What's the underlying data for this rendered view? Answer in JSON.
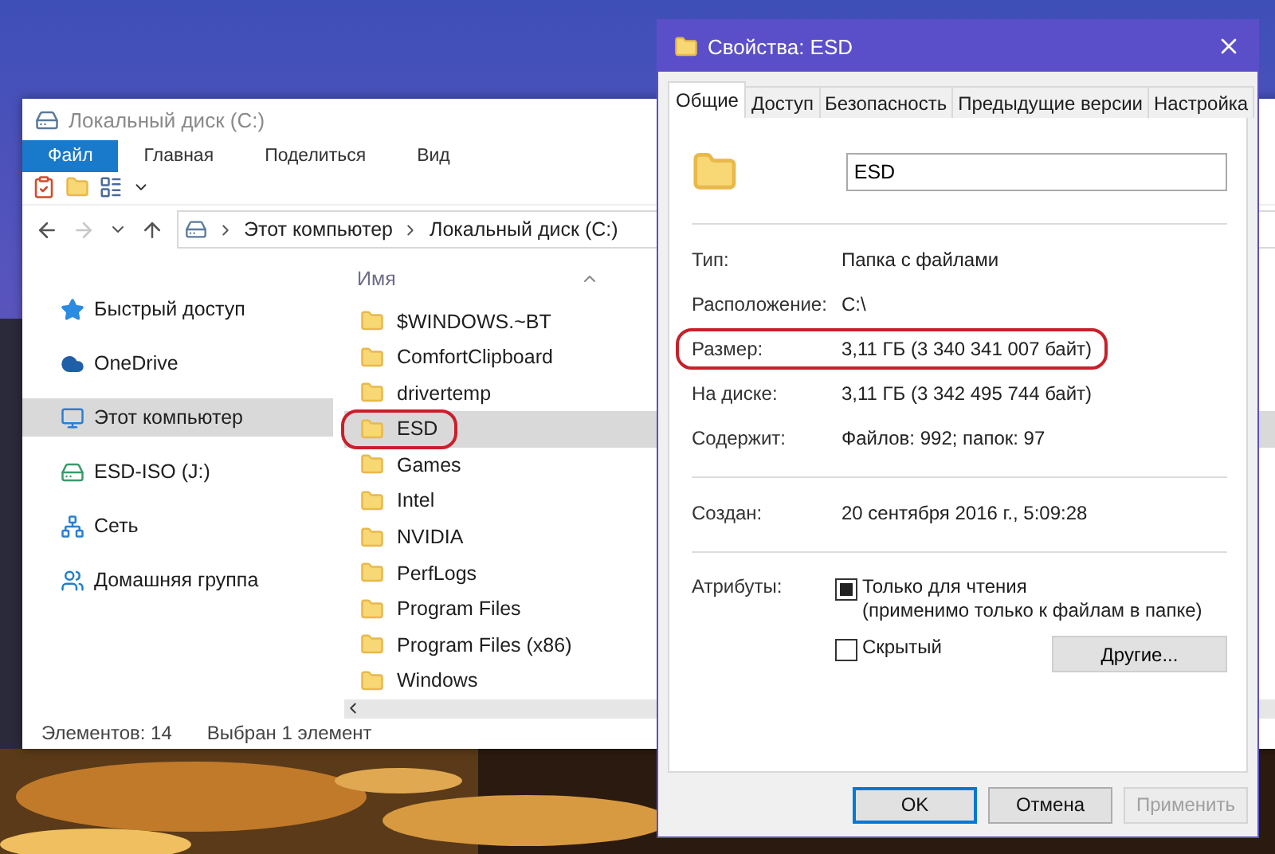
{
  "explorer": {
    "title": "Локальный диск (C:)",
    "ribbon_tabs": [
      {
        "label": "Файл",
        "kind": "menu"
      },
      {
        "label": "Главная",
        "kind": "tab"
      },
      {
        "label": "Поделиться",
        "kind": "tab"
      },
      {
        "label": "Вид",
        "kind": "tab"
      }
    ],
    "breadcrumb": [
      "Этот компьютер",
      "Локальный диск (C:)"
    ],
    "nav_items": [
      {
        "label": "Быстрый доступ",
        "kind": "star",
        "selected": false
      },
      {
        "label": "OneDrive",
        "kind": "cloud",
        "selected": false
      },
      {
        "label": "Этот компьютер",
        "kind": "computer",
        "selected": true
      },
      {
        "label": "ESD-ISO (J:)",
        "kind": "drive",
        "selected": false
      },
      {
        "label": "Сеть",
        "kind": "network",
        "selected": false
      },
      {
        "label": "Домашняя группа",
        "kind": "group",
        "selected": false
      }
    ],
    "column_header": "Имя",
    "files": [
      {
        "name": "$WINDOWS.~BT",
        "selected": false,
        "highlighted": false
      },
      {
        "name": "ComfortClipboard",
        "selected": false,
        "highlighted": false
      },
      {
        "name": "drivertemp",
        "selected": false,
        "highlighted": false
      },
      {
        "name": "ESD",
        "selected": true,
        "highlighted": true
      },
      {
        "name": "Games",
        "selected": false,
        "highlighted": false
      },
      {
        "name": "Intel",
        "selected": false,
        "highlighted": false
      },
      {
        "name": "NVIDIA",
        "selected": false,
        "highlighted": false
      },
      {
        "name": "PerfLogs",
        "selected": false,
        "highlighted": false
      },
      {
        "name": "Program Files",
        "selected": false,
        "highlighted": false
      },
      {
        "name": "Program Files (x86)",
        "selected": false,
        "highlighted": false
      },
      {
        "name": "Windows",
        "selected": false,
        "highlighted": false
      }
    ],
    "status": [
      "Элементов: 14",
      "Выбран 1 элемент"
    ]
  },
  "dialog": {
    "title": "Свойства: ESD",
    "tabs": [
      {
        "label": "Общие",
        "selected": true
      },
      {
        "label": "Доступ",
        "selected": false
      },
      {
        "label": "Безопасность",
        "selected": false
      },
      {
        "label": "Предыдущие версии",
        "selected": false
      },
      {
        "label": "Настройка",
        "selected": false
      }
    ],
    "name_value": "ESD",
    "sections": [
      {
        "rows": [
          {
            "label": "Тип:",
            "value": "Папка с файлами",
            "highlighted": false
          },
          {
            "label": "Расположение:",
            "value": "C:\\",
            "highlighted": false
          },
          {
            "label": "Размер:",
            "value": "3,11 ГБ (3 340 341 007 байт)",
            "highlighted": true
          },
          {
            "label": "На диске:",
            "value": "3,11 ГБ (3 342 495 744 байт)",
            "highlighted": false
          },
          {
            "label": "Содержит:",
            "value": "Файлов: 992; папок: 97",
            "highlighted": false
          }
        ]
      },
      {
        "rows": [
          {
            "label": "Создан:",
            "value": "20 сентября 2016 г., 5:09:28",
            "highlighted": false
          }
        ]
      }
    ],
    "attributes_label": "Атрибуты:",
    "attributes": [
      {
        "label": "Только для чтения\n(применимо только к файлам в папке)",
        "checked": false,
        "indeterminate": true
      },
      {
        "label": "Скрытый",
        "checked": false,
        "indeterminate": false
      }
    ],
    "other_button": "Другие...",
    "buttons": [
      {
        "label": "OK",
        "kind": "default"
      },
      {
        "label": "Отмена",
        "kind": "normal"
      },
      {
        "label": "Применить",
        "kind": "disabled"
      }
    ]
  }
}
